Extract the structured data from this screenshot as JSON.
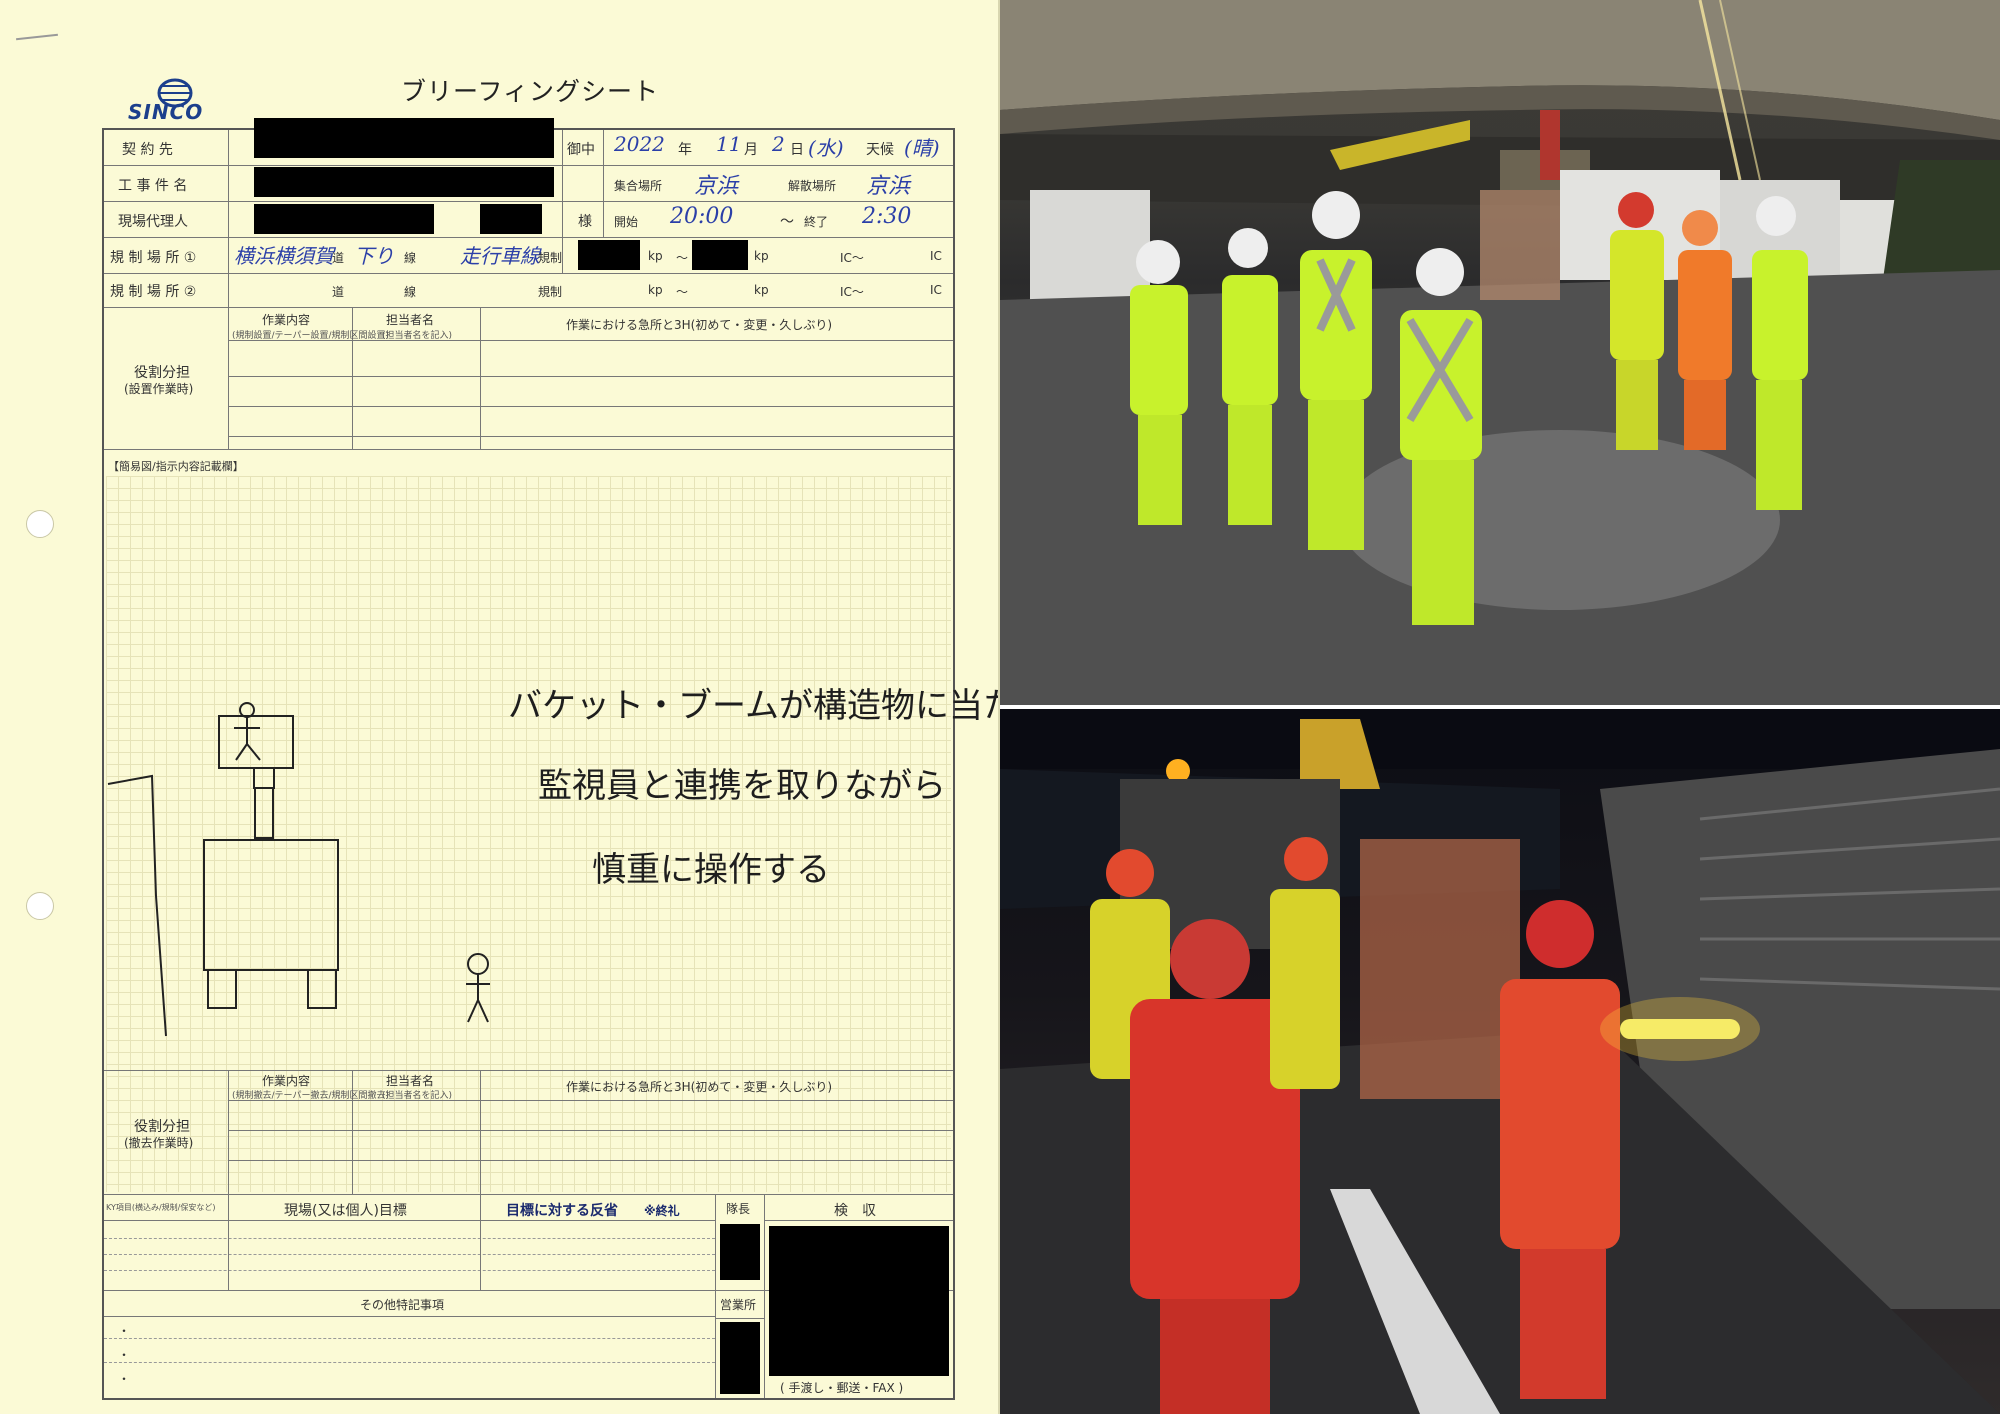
{
  "sheet": {
    "title": "ブリーフィングシート",
    "logo_text": "SINCO",
    "rows": {
      "contractor": {
        "label": "契 約 先",
        "honorific": "御中"
      },
      "date": {
        "year": "2022",
        "year_unit": "年",
        "month": "11",
        "month_unit": "月",
        "day": "2",
        "day_unit": "日",
        "weekday": "(水)",
        "weather_label": "天候",
        "weather": "(晴)"
      },
      "project": {
        "label": "工 事 件 名"
      },
      "gather": {
        "label": "集合場所",
        "value": "京浜"
      },
      "dismiss": {
        "label": "解散場所",
        "value": "京浜"
      },
      "agent": {
        "label": "現場代理人",
        "honorific": "様"
      },
      "start": {
        "label": "開始",
        "value": "20:00"
      },
      "end": {
        "label": "終了",
        "value": "2:30"
      },
      "tilde": "〜",
      "reg1": {
        "label": "規 制 場 所 ①",
        "road": "横浜横須賀",
        "road_unit": "道",
        "line": "下り",
        "line_unit": "線",
        "lane": "走行車線",
        "reg_label": "規制",
        "kp1": "kp",
        "kp_tilde": "〜",
        "kp2": "kp",
        "ic1": "IC〜",
        "ic2": "IC"
      },
      "reg2": {
        "label": "規 制 場 所 ②",
        "road_unit": "道",
        "line_unit": "線",
        "reg_label": "規制",
        "kp1": "kp",
        "kp_tilde": "〜",
        "kp2": "kp",
        "ic1": "IC〜",
        "ic2": "IC"
      }
    },
    "setup": {
      "role_label": "役割分担",
      "role_sub": "(設置作業時)",
      "col_work": "作業内容",
      "col_work_note": "(規制設置/テーパー設置/規制区間設置)",
      "col_person": "担当者名",
      "col_person_note": "(担当者名を記入)",
      "col_points": "作業における急所と3H(初めて・変更・久しぶり)"
    },
    "sketch": {
      "header": "【簡易図/指示内容記載欄】",
      "line1": "バケット・ブームが構造物に当たる",
      "line2": "監視員と連携を取りながら",
      "line3": "慎重に操作する"
    },
    "removal": {
      "role_label": "役割分担",
      "role_sub": "(撤去作業時)",
      "col_work": "作業内容",
      "col_work_note": "(規制撤去/テーパー撤去/規制区間撤去)",
      "col_person": "担当者名",
      "col_person_note": "(担当者名を記入)",
      "col_points": "作業における急所と3H(初めて・変更・久しぶり)"
    },
    "ky": {
      "col1": "KY項目(横込み/規制/保安など)",
      "col2": "現場(又は個人)目標",
      "col3": "目標に対する反省",
      "col3_note": "※終礼",
      "leader": "隊長",
      "receipt": "検　収",
      "office": "営業所"
    },
    "other": {
      "label": "その他特記事項",
      "bullets": [
        "・",
        "・",
        "・"
      ]
    },
    "delivery": "( 手渡し・郵送・FAX )"
  },
  "colors": {
    "paper": "#fbfad6",
    "ink_blue": "#2b3fa8",
    "redaction": "#000000",
    "vest": "#c8f22c"
  },
  "photos": {
    "top": {
      "subject": "night briefing under highway overpass"
    },
    "bottom": {
      "subject": "night briefing beside road with red light baton"
    }
  }
}
